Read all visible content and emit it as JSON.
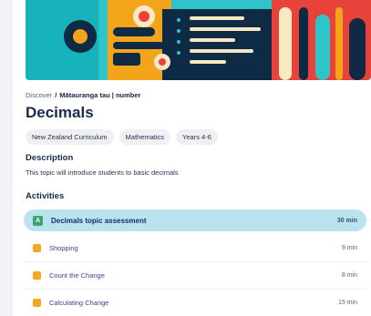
{
  "breadcrumb": {
    "root": "Discover",
    "separator": "/",
    "current": "Mātauranga tau | number"
  },
  "topic": {
    "title": "Decimals"
  },
  "tags": [
    "New Zealand Curriculum",
    "Mathematics",
    "Years 4-6"
  ],
  "description": {
    "heading": "Description",
    "text": "This topic will introduce students to basic decimals"
  },
  "activities": {
    "heading": "Activities",
    "items": [
      {
        "label": "Decimals topic assessment",
        "duration": "30 min",
        "icon": "assessment-icon",
        "icon_glyph": "A",
        "highlighted": true
      },
      {
        "label": "Shopping",
        "duration": "9 min",
        "icon": "lesson-icon",
        "icon_glyph": "",
        "highlighted": false
      },
      {
        "label": "Count the Change",
        "duration": "8 min",
        "icon": "lesson-icon",
        "icon_glyph": "",
        "highlighted": false
      },
      {
        "label": "Calculating Change",
        "duration": "15 min",
        "icon": "lesson-icon",
        "icon_glyph": "",
        "highlighted": false
      }
    ]
  },
  "colors": {
    "highlight": "#b9e4ee",
    "assessment_icon": "#3aa56f",
    "lesson_icon": "#f5a623",
    "title": "#1b2a50"
  }
}
